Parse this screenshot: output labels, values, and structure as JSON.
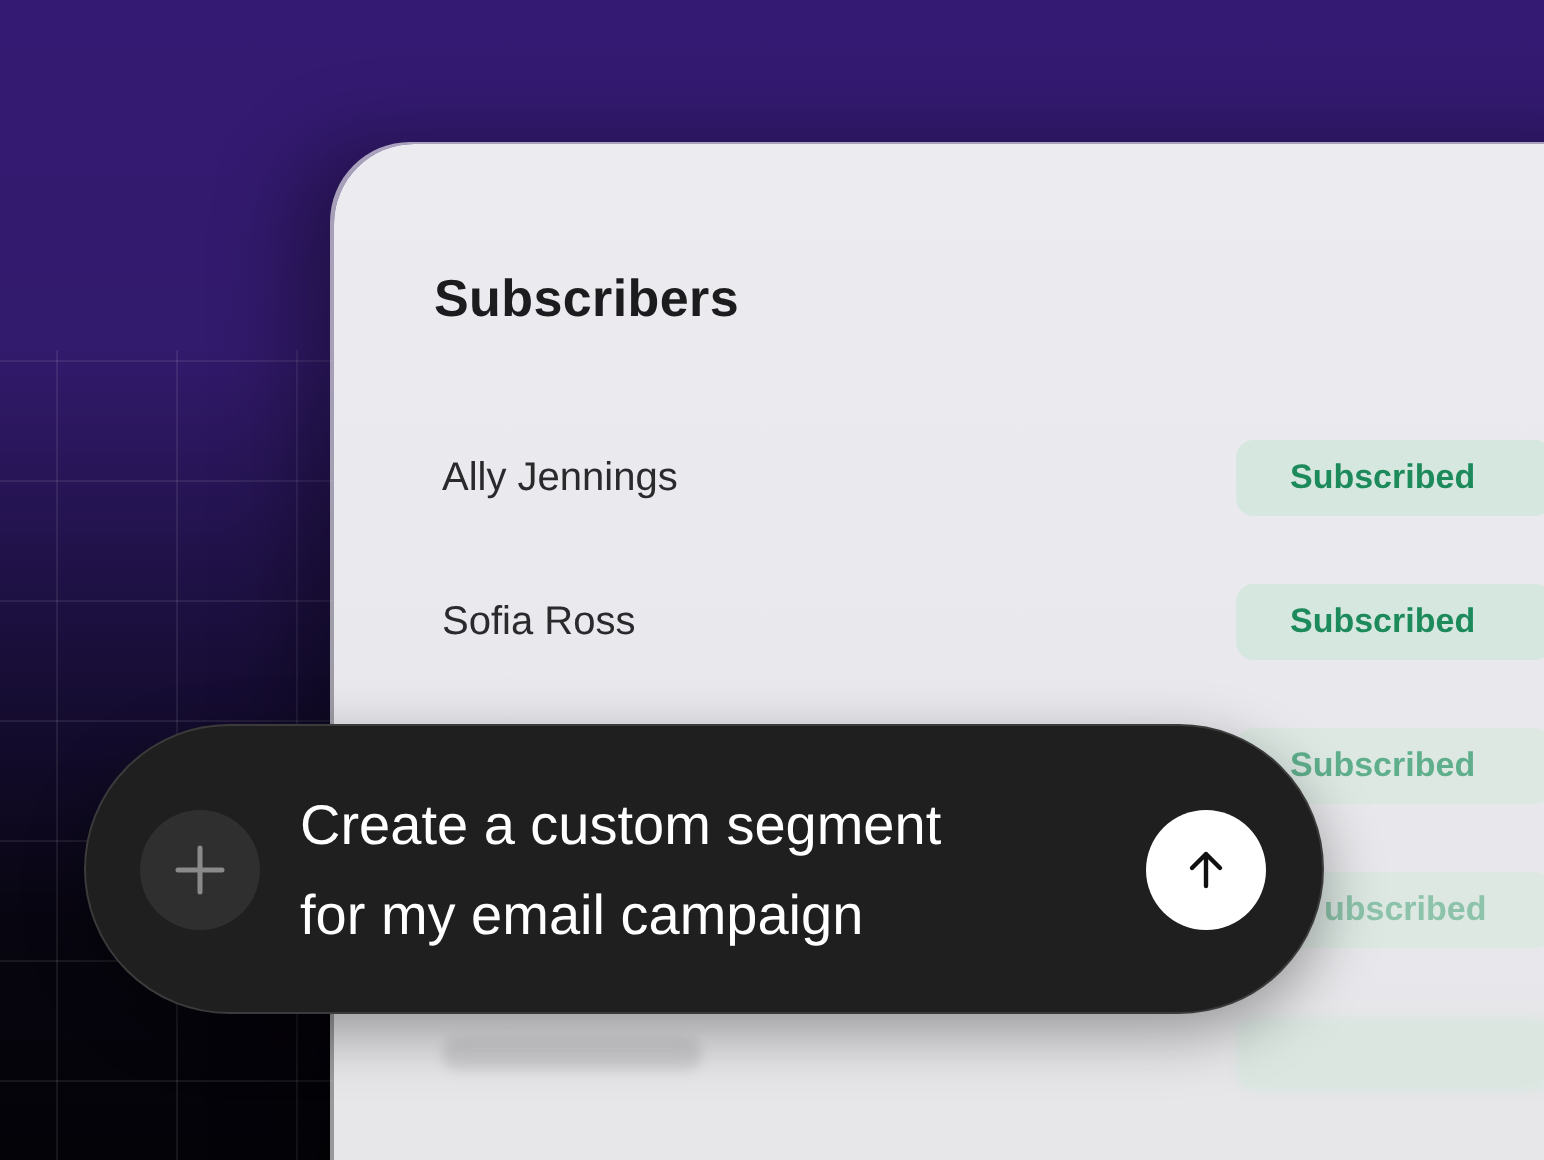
{
  "card": {
    "title": "Subscribers",
    "rows": [
      {
        "kind": "plain",
        "name": "Ally Jennings",
        "status": "Subscribed"
      },
      {
        "kind": "plain",
        "name": "Sofia Ross",
        "status": "Subscribed"
      },
      {
        "kind": "faded",
        "status": "Subscribed"
      },
      {
        "kind": "faded",
        "status": "ubscribed"
      },
      {
        "kind": "blurred"
      }
    ]
  },
  "prompt": {
    "text": "Create a custom segment\nfor my email campaign"
  }
}
